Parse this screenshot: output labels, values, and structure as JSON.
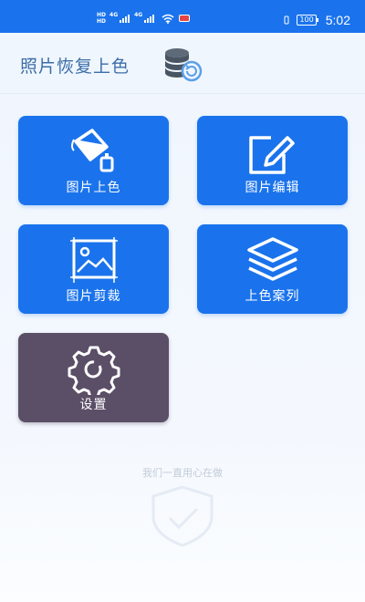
{
  "status_bar": {
    "hd1": "HD",
    "hd2": "HD",
    "net1": "4G",
    "net2": "4G",
    "battery": "100",
    "time": "5:02"
  },
  "header": {
    "title": "照片恢复上色"
  },
  "tiles": [
    {
      "label": "图片上色"
    },
    {
      "label": "图片编辑"
    },
    {
      "label": "图片剪裁"
    },
    {
      "label": "上色案列"
    },
    {
      "label": "设置"
    }
  ],
  "footer": {
    "slogan": "我们一直用心在做"
  },
  "colors": {
    "primary": "#1a73ec",
    "settings_tile": "#5b4e67",
    "title": "#3a6ea8"
  }
}
